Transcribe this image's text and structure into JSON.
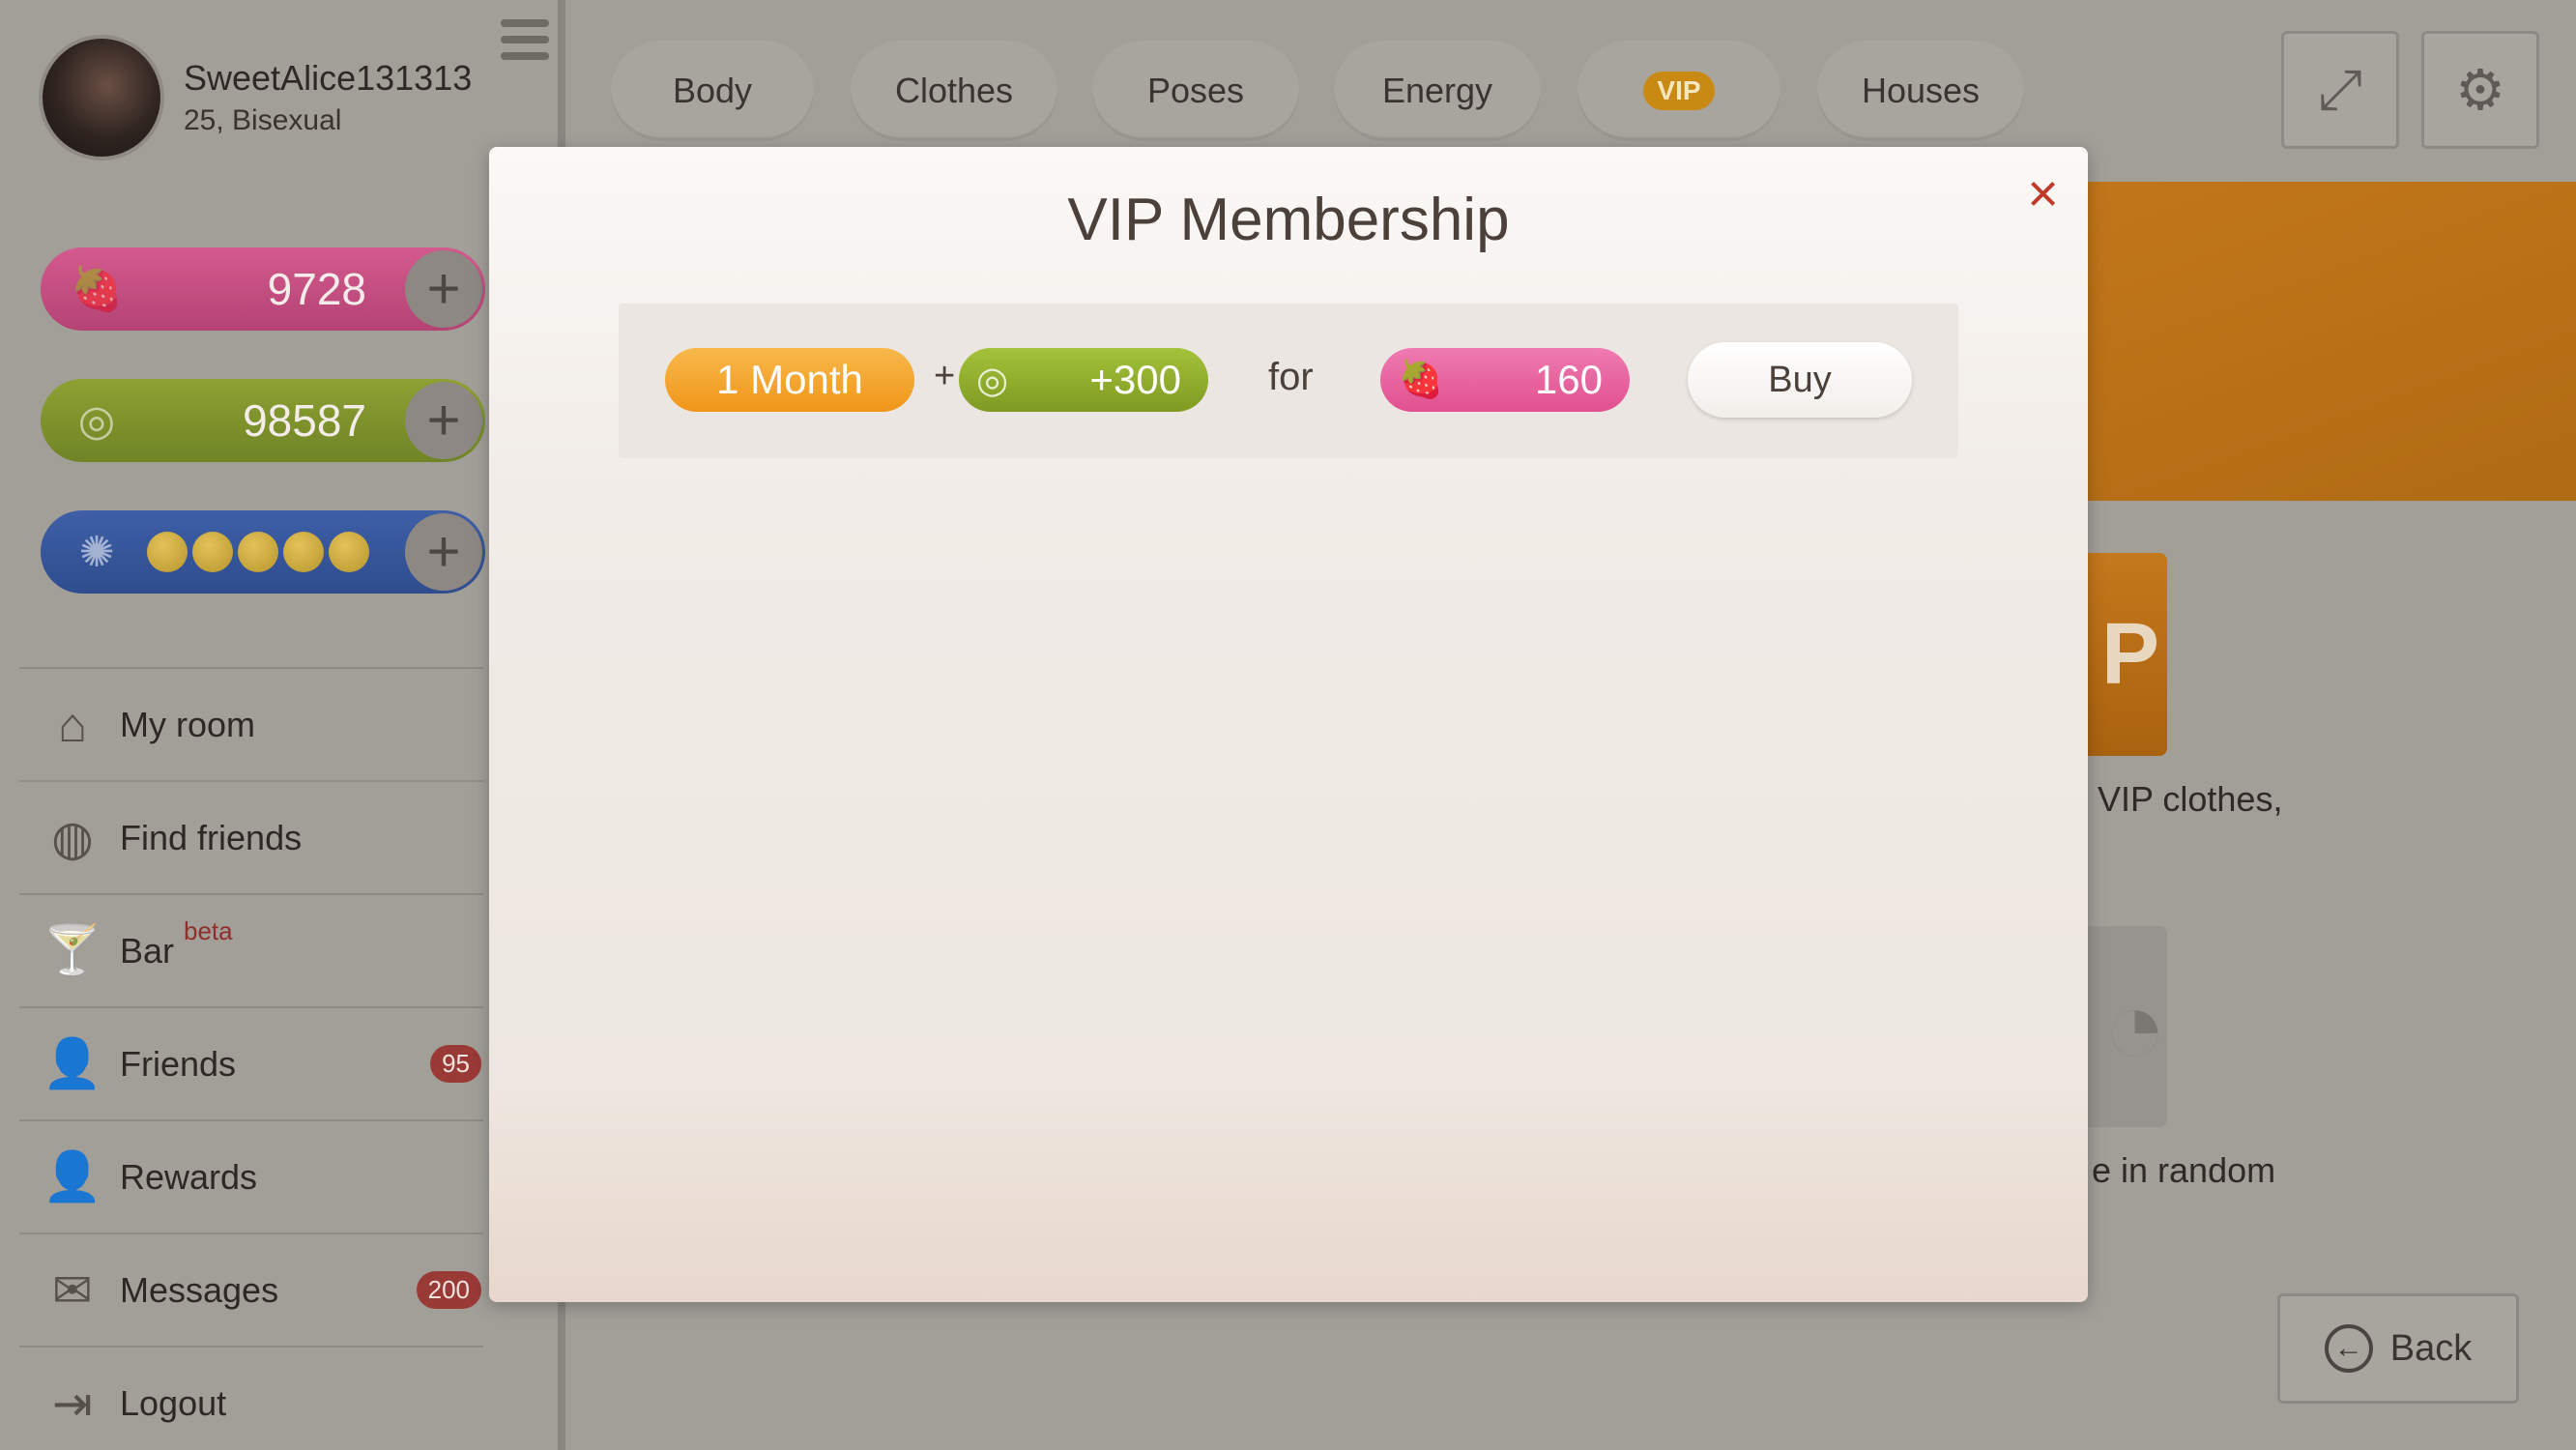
{
  "profile": {
    "name": "SweetAlice131313",
    "subtitle": "25, Bisexual"
  },
  "currencies": {
    "strawberries": {
      "value": "9728",
      "icon": "strawberry-icon"
    },
    "coins": {
      "value": "98587",
      "icon": "coins-icon"
    },
    "energy": {
      "level": 5,
      "max": 5,
      "icon": "energy-icon"
    }
  },
  "menu": [
    {
      "label": "My room",
      "icon": "house-icon"
    },
    {
      "label": "Find friends",
      "icon": "globe-icon"
    },
    {
      "label": "Bar",
      "icon": "cocktail-icon",
      "tag": "beta"
    },
    {
      "label": "Friends",
      "icon": "person-icon",
      "badge": "95"
    },
    {
      "label": "Rewards",
      "icon": "reward-icon"
    },
    {
      "label": "Messages",
      "icon": "envelope-icon",
      "badge": "200"
    },
    {
      "label": "Logout",
      "icon": "logout-icon"
    }
  ],
  "tabs": [
    "Body",
    "Clothes",
    "Poses",
    "Energy",
    "VIP",
    "Houses"
  ],
  "background": {
    "logo_letter": "P",
    "text1": "VIP clothes,",
    "text2": "e in random",
    "back_label": "Back"
  },
  "modal": {
    "title": "VIP Membership",
    "close": "×",
    "offer": {
      "duration": "1 Month",
      "plus": "+",
      "coins": "+300",
      "for_label": "for",
      "price": "160",
      "buy_label": "Buy"
    }
  },
  "colors": {
    "strawberry": "#e0508f",
    "coin": "#7e9a22",
    "month": "#f0961a",
    "close": "#c0392b"
  }
}
